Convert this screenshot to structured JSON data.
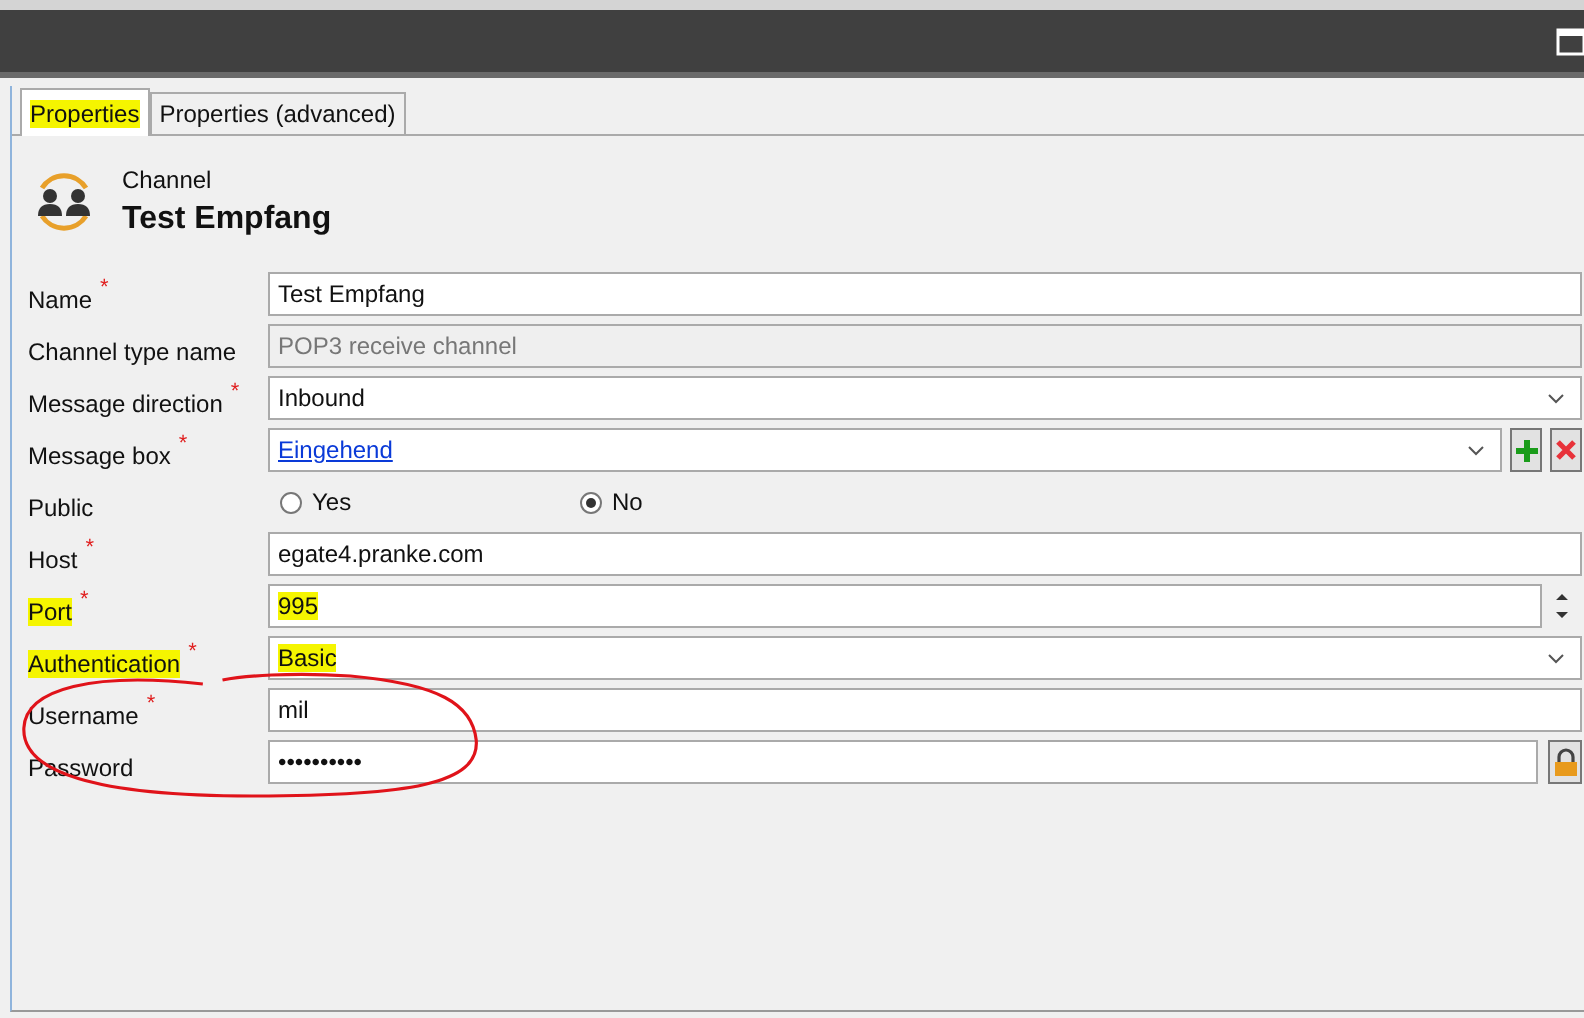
{
  "tabs": [
    {
      "label": "Properties",
      "selected": true,
      "highlighted": true
    },
    {
      "label": "Properties (advanced)",
      "selected": false,
      "highlighted": false
    }
  ],
  "header": {
    "caption": "Channel",
    "title": "Test Empfang"
  },
  "fields": [
    {
      "kind": "text",
      "label": "Name",
      "asterisk": "*",
      "value": "Test Empfang",
      "disabled": false,
      "highlighted": false,
      "circled": false
    },
    {
      "kind": "text",
      "label": "Channel type name",
      "value": "POP3 receive channel",
      "disabled": true,
      "highlighted": false,
      "circled": false
    },
    {
      "kind": "dropdown",
      "label": "Message direction",
      "asterisk": "*",
      "value": "Inbound",
      "highlighted": false,
      "circled": false
    },
    {
      "kind": "lookup",
      "label": "Message box",
      "asterisk": "*",
      "value": "Eingehend",
      "highlighted": false,
      "circled": false
    },
    {
      "kind": "radio",
      "label": "Public",
      "highlighted": false,
      "circled": false,
      "options": [
        {
          "label": "Yes",
          "selected": false
        },
        {
          "label": "No",
          "selected": true
        }
      ]
    },
    {
      "kind": "text",
      "label": "Host",
      "asterisk": "*",
      "value": "egate4.pranke.com",
      "disabled": false,
      "highlighted": false,
      "circled": false
    },
    {
      "kind": "spinner",
      "label": "Port",
      "asterisk": "*",
      "value": "995",
      "highlighted": true,
      "circled": false
    },
    {
      "kind": "dropdown",
      "label": "Authentication",
      "asterisk": "*",
      "value": "Basic",
      "highlighted": true,
      "circled": false
    },
    {
      "kind": "text",
      "label": "Username",
      "asterisk": "*",
      "value": "mil",
      "disabled": false,
      "highlighted": false,
      "circled": true
    },
    {
      "kind": "password",
      "label": "Password",
      "value": "••••••••••",
      "highlighted": false,
      "circled": true
    }
  ]
}
